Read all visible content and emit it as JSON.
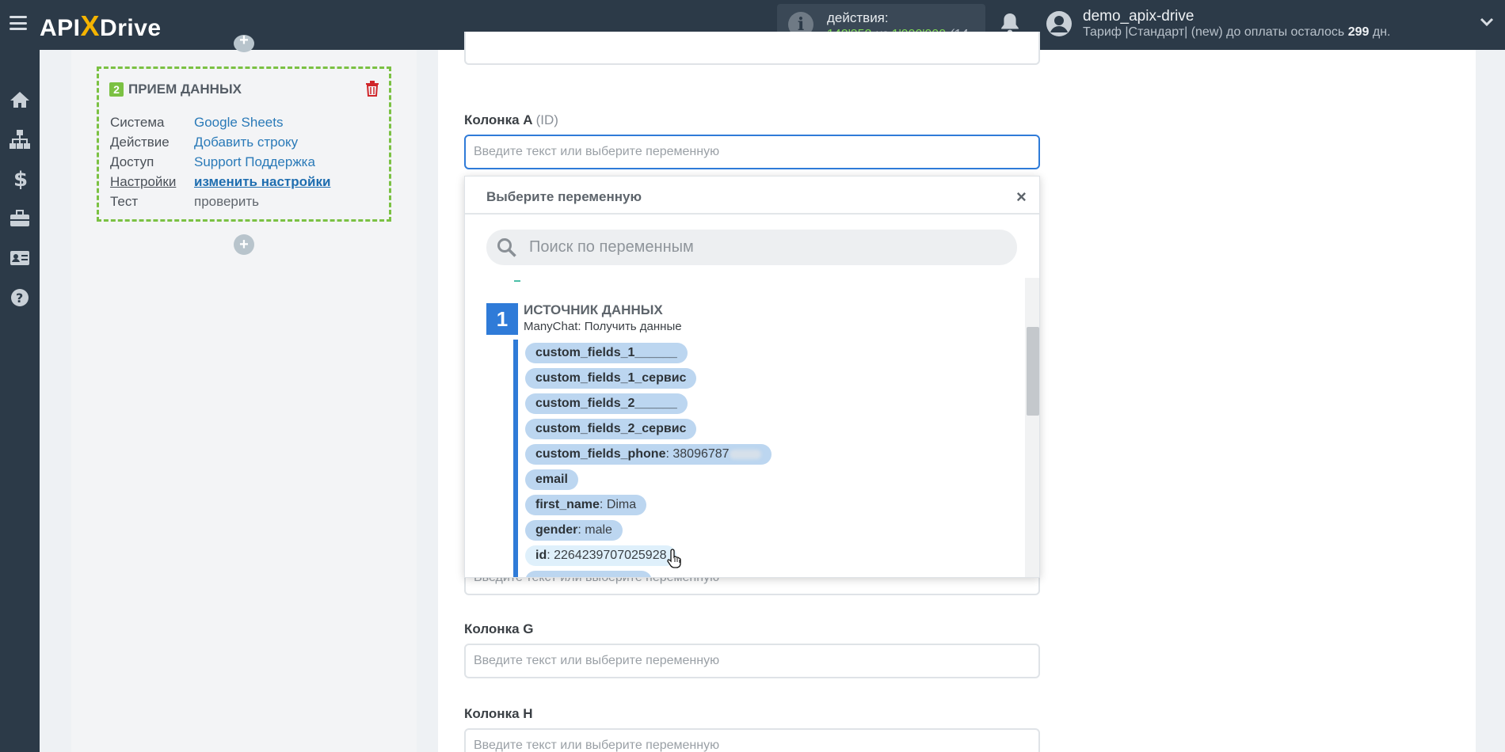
{
  "app": {
    "logo_api": "API",
    "logo_x": "X",
    "logo_drive": "Drive"
  },
  "actions": {
    "label": "действия:",
    "used": "142'352",
    "of": "из",
    "limit": "1'000'000",
    "tail": "(14"
  },
  "user": {
    "name": "demo_apix-drive",
    "plan_prefix": "Тариф |Стандарт| (new) до оплаты осталось ",
    "plan_days": "299",
    "plan_suffix": " дн."
  },
  "rail_icons": [
    "home-icon",
    "sitemap-icon",
    "dollar-icon",
    "briefcase-icon",
    "id-card-icon",
    "help-icon"
  ],
  "step": {
    "number": "2",
    "title": "ПРИЕМ ДАННЫХ",
    "rows": [
      {
        "key": "Система",
        "value": "Google Sheets"
      },
      {
        "key": "Действие",
        "value": "Добавить строку"
      },
      {
        "key": "Доступ",
        "value": "Support Поддержка"
      },
      {
        "key": "Настройки",
        "value": "изменить настройки"
      },
      {
        "key": "Тест",
        "value": "проверить"
      }
    ]
  },
  "form": {
    "col_a": {
      "label": "Колонка A",
      "hint": "(ID)",
      "placeholder": "Введите текст или выберите переменную"
    },
    "col_f_placeholder": "Введите текст или выберите переменную",
    "col_g": {
      "label": "Колонка G",
      "placeholder": "Введите текст или выберите переменную"
    },
    "col_h": {
      "label": "Колонка H",
      "placeholder": "Введите текст или выберите переменную"
    }
  },
  "dropdown": {
    "title": "Выберите переменную",
    "close": "×",
    "search_placeholder": "Поиск по переменным",
    "source": {
      "number": "1",
      "title": "ИСТОЧНИК ДАННЫХ",
      "subtitle": "ManyChat: Получить данные"
    },
    "variables": [
      {
        "name": "custom_fields_1______",
        "value": ""
      },
      {
        "name": "custom_fields_1_сервис",
        "value": ""
      },
      {
        "name": "custom_fields_2______",
        "value": ""
      },
      {
        "name": "custom_fields_2_сервис",
        "value": ""
      },
      {
        "name": "custom_fields_phone",
        "value": ": 38096787"
      },
      {
        "name": "email",
        "value": ""
      },
      {
        "name": "first_name",
        "value": ": Dima"
      },
      {
        "name": "gender",
        "value": ": male"
      },
      {
        "name": "id",
        "value": ": 2264239707025928"
      }
    ]
  },
  "colors": {
    "accent": "#2f7bd8",
    "topbar": "#2c3a48",
    "green": "#7bc143",
    "chip": "#bcd6f0"
  }
}
